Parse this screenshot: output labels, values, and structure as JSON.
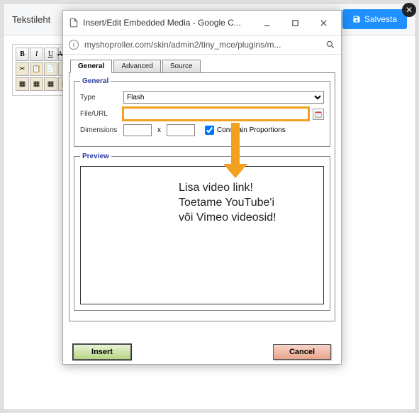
{
  "header": {
    "page_title": "Tekstileht",
    "save_label": "Salvesta"
  },
  "toolbar": {
    "bold": "B",
    "italic": "I",
    "underline": "U",
    "strike": "ABC"
  },
  "dialog": {
    "window_title": "Insert/Edit Embedded Media - Google C...",
    "url": "myshoproller.com/skin/admin2/tiny_mce/plugins/m...",
    "tabs": {
      "general": "General",
      "advanced": "Advanced",
      "source": "Source"
    },
    "general": {
      "legend": "General",
      "type_label": "Type",
      "type_value": "Flash",
      "url_label": "File/URL",
      "url_value": "",
      "dim_label": "Dimensions",
      "dim_w": "",
      "dim_h": "",
      "dim_x": "x",
      "constrain_label": "Constrain Proportions"
    },
    "preview": {
      "legend": "Preview"
    },
    "footer": {
      "insert": "Insert",
      "cancel": "Cancel"
    }
  },
  "annotation": {
    "line1": "Lisa video link!",
    "line2": "Toetame YouTube'i",
    "line3": "või Vimeo videosid!"
  }
}
